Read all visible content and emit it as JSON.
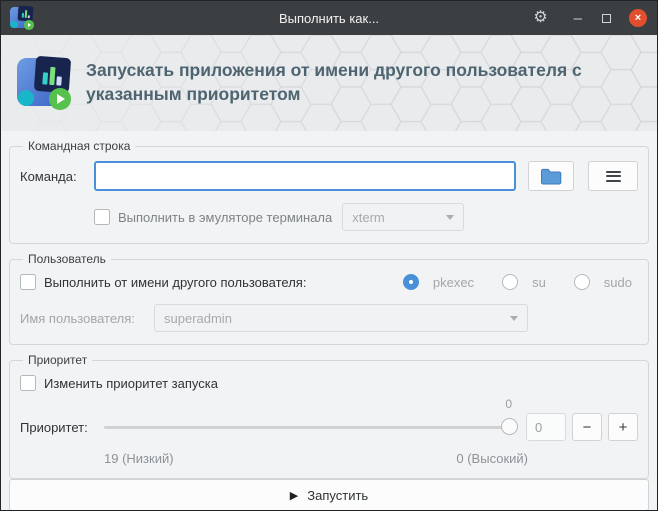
{
  "window": {
    "title": "Выполнить как...",
    "icons": {
      "gear": "⚙",
      "minimize": "–",
      "close": "×"
    }
  },
  "header": {
    "title": "Запускать приложения от имени другого пользователя с указанным приоритетом"
  },
  "command_group": {
    "legend": "Командная строка",
    "command_label": "Команда:",
    "command_value": "",
    "terminal_checkbox": "Выполнить в эмуляторе терминала",
    "terminal_select": "xterm"
  },
  "user_group": {
    "legend": "Пользователь",
    "runas_checkbox": "Выполнить от имени другого пользователя:",
    "radios": [
      {
        "label": "pkexec",
        "selected": true
      },
      {
        "label": "su",
        "selected": false
      },
      {
        "label": "sudo",
        "selected": false
      }
    ],
    "username_label": "Имя пользователя:",
    "username_value": "superadmin"
  },
  "priority_group": {
    "legend": "Приоритет",
    "change_checkbox": "Изменить приоритет запуска",
    "priority_label": "Приоритет:",
    "slider_value": "0",
    "spin_value": "0",
    "minus": "−",
    "plus": "+",
    "min_label": "19 (Низкий)",
    "max_label": "0 (Высокий)"
  },
  "run_button": {
    "label": "Запустить",
    "icon": "▶"
  },
  "colors": {
    "accent": "#4a90d9",
    "titlebar": "#3b3f41",
    "close_button": "#e14f2f",
    "header_bg": "#e9ebed",
    "window_bg": "#f2f3f4"
  }
}
